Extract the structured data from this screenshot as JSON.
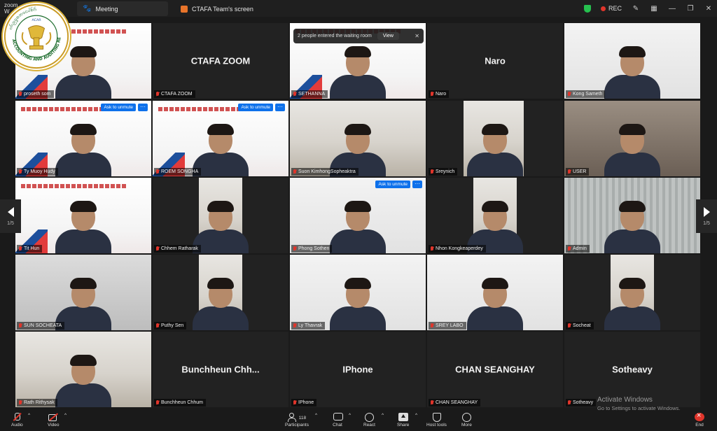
{
  "app": {
    "brand_top": "zoom",
    "brand_bottom": "W",
    "tabs": [
      {
        "label": "Meeting",
        "icon": "paw-icon"
      },
      {
        "label": "CTAFA Team's screen",
        "icon": "share-screen-icon"
      }
    ],
    "rec_label": "REC"
  },
  "waiting_room": {
    "message": "2 people entered the waiting room",
    "view_label": "View"
  },
  "page_indicator": {
    "left": "1/5",
    "right": "1/5"
  },
  "unmute_label": "Ask to unmute",
  "more_label": "···",
  "participants": [
    {
      "name": "proseth som",
      "big": ""
    },
    {
      "name": "CTAFA ZOOM",
      "big": "CTAFA ZOOM"
    },
    {
      "name": "SETHANNA",
      "big": ""
    },
    {
      "name": "Naro",
      "big": "Naro"
    },
    {
      "name": "Kong Sameth",
      "big": ""
    },
    {
      "name": "Ty Muoy Hudy",
      "big": ""
    },
    {
      "name": "ROEM SONGHA",
      "big": ""
    },
    {
      "name": "Suon KimhongSopheaktra",
      "big": ""
    },
    {
      "name": "Sreynich",
      "big": ""
    },
    {
      "name": "USER",
      "big": ""
    },
    {
      "name": "Tit Hun",
      "big": ""
    },
    {
      "name": "Chhem Ratharak",
      "big": ""
    },
    {
      "name": "Phong Sothen",
      "big": ""
    },
    {
      "name": "Nhon Kongkeaperdey",
      "big": ""
    },
    {
      "name": "Admin",
      "big": ""
    },
    {
      "name": "SUN SOCHEATA",
      "big": ""
    },
    {
      "name": "Puthy Sen",
      "big": ""
    },
    {
      "name": "Ly Thavrak",
      "big": ""
    },
    {
      "name": "SREY LABO",
      "big": ""
    },
    {
      "name": "Socheat",
      "big": ""
    },
    {
      "name": "Rath Rithysak",
      "big": ""
    },
    {
      "name": "Bunchheun Chhum",
      "big": "Bunchheun Chh..."
    },
    {
      "name": "IPhone",
      "big": "IPhone"
    },
    {
      "name": "CHAN SEANGHAY",
      "big": "CHAN SEANGHAY"
    },
    {
      "name": "Sotheavy",
      "big": "Sotheavy"
    }
  ],
  "activate": {
    "title": "Activate Windows",
    "subtitle": "Go to Settings to activate Windows."
  },
  "toolbar": {
    "audio": "Audio",
    "video": "Video",
    "participants": "Participants",
    "participants_count": "118",
    "chat": "Chat",
    "react": "React",
    "share": "Share",
    "host_tools": "Host tools",
    "more": "More",
    "end": "End"
  },
  "colors": {
    "active_speaker": "#3ec45f",
    "unmute_blue": "#0e71eb",
    "muted_red": "#e0352b"
  }
}
